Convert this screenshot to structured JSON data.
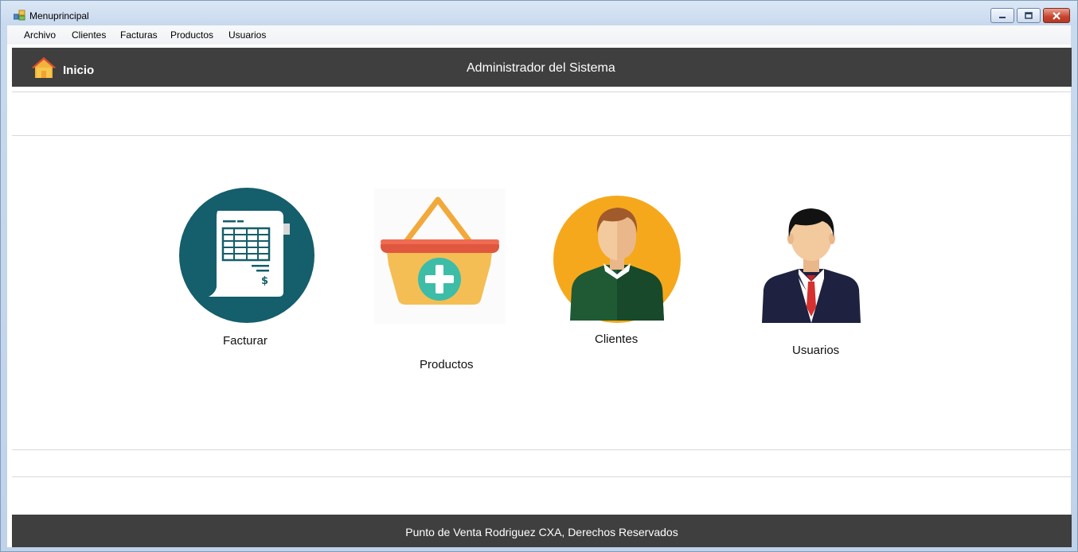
{
  "window": {
    "title": "Menuprincipal",
    "controls": {
      "minimize": "minimize-icon",
      "maximize": "maximize-icon",
      "close": "close-icon"
    }
  },
  "menubar": {
    "items": [
      {
        "label": "Archivo"
      },
      {
        "label": "Clientes"
      },
      {
        "label": "Facturas"
      },
      {
        "label": "Productos"
      },
      {
        "label": "Usuarios"
      }
    ]
  },
  "header": {
    "home_label": "Inicio",
    "title": "Administrador del Sistema"
  },
  "tiles": [
    {
      "label": "Facturar",
      "icon": "invoice-icon"
    },
    {
      "label": "Productos",
      "icon": "basket-icon"
    },
    {
      "label": "Clientes",
      "icon": "client-person-icon"
    },
    {
      "label": "Usuarios",
      "icon": "user-businessman-icon"
    }
  ],
  "footer": {
    "text": "Punto de Venta Rodriguez CXA, Derechos Reservados"
  },
  "colors": {
    "header_bg": "#3f3f3f",
    "invoice_circle": "#155e6b",
    "client_circle": "#f6a81c",
    "basket_rim": "#e0573f",
    "basket_body": "#f4be55",
    "basket_plus": "#3dbda8"
  }
}
